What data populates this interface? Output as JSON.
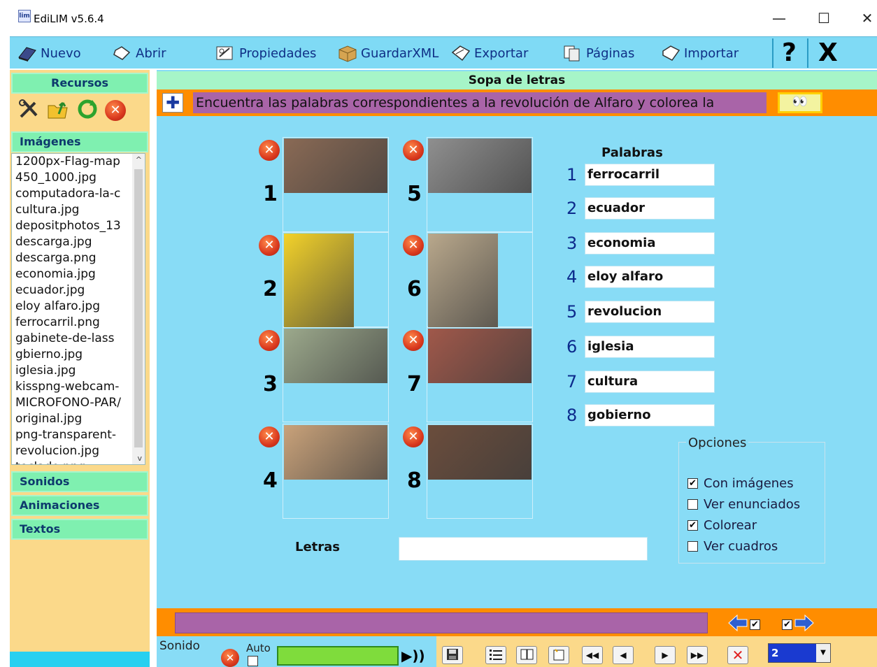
{
  "window": {
    "title": "EdiLIM v5.6.4",
    "app_icon": "lim",
    "min_glyph": "—",
    "max_glyph": "☐",
    "close_glyph": "✕"
  },
  "toolbar": {
    "items": [
      {
        "label": "Nuevo",
        "icon": "book-icon"
      },
      {
        "label": "Abrir",
        "icon": "open-icon"
      },
      {
        "label": "Propiedades",
        "icon": "properties-icon"
      },
      {
        "label": "GuardarXML",
        "icon": "box-icon"
      },
      {
        "label": "Exportar",
        "icon": "export-icon"
      },
      {
        "label": "Páginas",
        "icon": "pages-icon"
      },
      {
        "label": "Importar",
        "icon": "import-icon"
      }
    ],
    "help": "?",
    "exit": "X"
  },
  "sidebar": {
    "header": "Recursos",
    "sections": {
      "images": "Imágenes",
      "sounds": "Sonidos",
      "animations": "Animaciones",
      "texts": "Textos"
    },
    "files": [
      "1200px-Flag-map",
      "450_1000.jpg",
      "computadora-la-c",
      "cultura.jpg",
      "depositphotos_13",
      "descarga.jpg",
      "descarga.png",
      "economia.jpg",
      "ecuador.jpg",
      "eloy alfaro.jpg",
      "ferrocarril.png",
      "gabinete-de-lass",
      "gbierno.jpg",
      "iglesia.jpg",
      "kisspng-webcam-",
      "MICROFONO-PAR/",
      "original.jpg",
      "png-transparent-",
      "revolucion.jpg",
      "teclado.png"
    ]
  },
  "page": {
    "title": "Sopa de letras",
    "instruction": "Encuentra las palabras correspondientes a la revolución de Alfaro y colorea la",
    "images": [
      {
        "n": "1",
        "subject": "ferrocarril",
        "color": "#8a6a55"
      },
      {
        "n": "2",
        "subject": "ecuador",
        "color": "#f3d22a"
      },
      {
        "n": "3",
        "subject": "economia",
        "color": "#9ca98c"
      },
      {
        "n": "4",
        "subject": "eloy alfaro",
        "color": "#c9a27a"
      },
      {
        "n": "5",
        "subject": "revolucion",
        "color": "#8f8f8f"
      },
      {
        "n": "6",
        "subject": "iglesia",
        "color": "#b9a88c"
      },
      {
        "n": "7",
        "subject": "cultura",
        "color": "#a0584a"
      },
      {
        "n": "8",
        "subject": "gobierno",
        "color": "#6b4d3c"
      }
    ],
    "words_title": "Palabras",
    "words": [
      {
        "n": "1",
        "text": "ferrocarril"
      },
      {
        "n": "2",
        "text": "ecuador"
      },
      {
        "n": "3",
        "text": "economia"
      },
      {
        "n": "4",
        "text": "eloy alfaro"
      },
      {
        "n": "5",
        "text": "revolucion"
      },
      {
        "n": "6",
        "text": "iglesia"
      },
      {
        "n": "7",
        "text": "cultura"
      },
      {
        "n": "8",
        "text": "gobierno"
      }
    ],
    "letters_label": "Letras",
    "letters_value": "",
    "options": {
      "legend": "Opciones",
      "items": [
        {
          "label": "Con imágenes",
          "checked": true
        },
        {
          "label": "Ver enunciados",
          "checked": false
        },
        {
          "label": "Colorear",
          "checked": true
        },
        {
          "label": "Ver cuadros",
          "checked": false
        }
      ]
    }
  },
  "bottom": {
    "sound_label": "Sonido",
    "auto_label": "Auto",
    "page_select": "2",
    "check": "✔"
  },
  "colors": {
    "accent_blue": "#88dcf6",
    "orange": "#ff8d00",
    "purple": "#a964a8",
    "green": "#7ff0b0",
    "sand": "#fbd98a"
  }
}
